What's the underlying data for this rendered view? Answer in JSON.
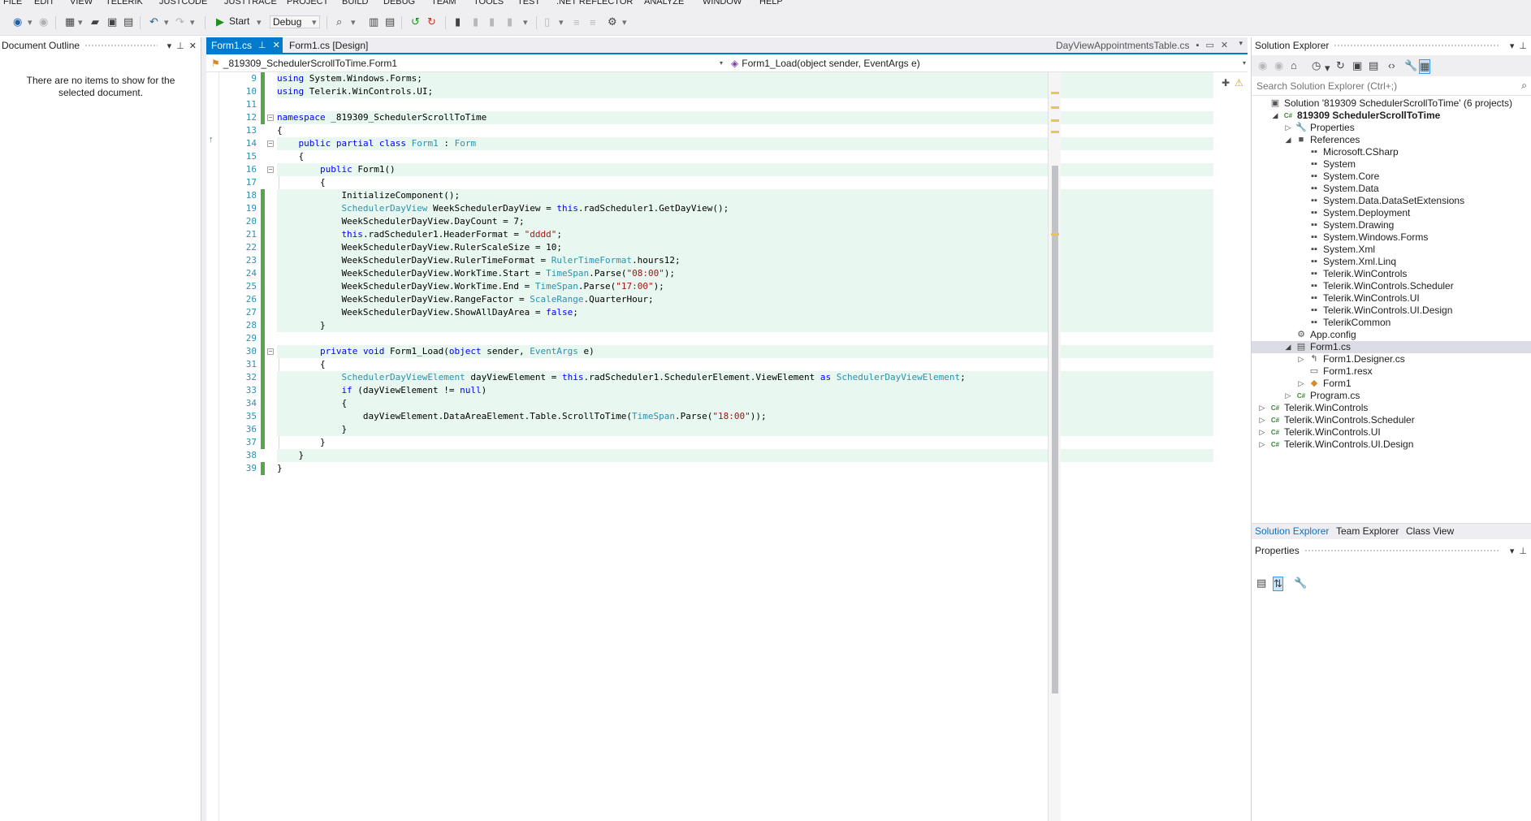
{
  "menu": [
    "FILE",
    "EDIT",
    "VIEW",
    "TELERIK",
    "JUSTCODE",
    "JUSTTRACE",
    "PROJECT",
    "BUILD",
    "DEBUG",
    "TEAM",
    "TOOLS",
    "TEST",
    ".NET REFLECTOR",
    "ANALYZE",
    "WINDOW",
    "HELP"
  ],
  "toolbar": {
    "start_label": "Start",
    "config_value": "Debug"
  },
  "document_outline": {
    "title": "Document Outline",
    "empty_message": "There are no items to show for the selected document."
  },
  "tabs": {
    "items": [
      {
        "label": "Form1.cs",
        "active": true
      },
      {
        "label": "Form1.cs [Design]",
        "active": false
      }
    ],
    "preview_tab": "DayViewAppointmentsTable.cs"
  },
  "navbar": {
    "type_combo": "_819309_SchedulerScrollToTime.Form1",
    "member_combo": "Form1_Load(object sender, EventArgs e)"
  },
  "code": [
    {
      "n": "9",
      "fold": "",
      "hl": true,
      "chg": "saved",
      "indent": 0,
      "segs": [
        [
          "k",
          "using"
        ],
        [
          "p",
          " System.Windows.Forms;"
        ]
      ]
    },
    {
      "n": "10",
      "fold": "",
      "hl": true,
      "chg": "saved",
      "indent": 0,
      "segs": [
        [
          "k",
          "using"
        ],
        [
          "p",
          " Telerik.WinControls.UI;"
        ]
      ]
    },
    {
      "n": "11",
      "fold": "",
      "hl": false,
      "chg": "saved",
      "indent": 0,
      "segs": []
    },
    {
      "n": "12",
      "fold": "−",
      "hl": true,
      "chg": "saved",
      "indent": 0,
      "segs": [
        [
          "k",
          "namespace"
        ],
        [
          "p",
          " _819309_SchedulerScrollToTime"
        ]
      ]
    },
    {
      "n": "13",
      "fold": "",
      "hl": false,
      "chg": "",
      "indent": 0,
      "segs": [
        [
          "p",
          "{"
        ]
      ]
    },
    {
      "n": "14",
      "fold": "−",
      "hl": true,
      "chg": "",
      "indent": 1,
      "segs": [
        [
          "k",
          "public"
        ],
        [
          "p",
          " "
        ],
        [
          "k",
          "partial"
        ],
        [
          "p",
          " "
        ],
        [
          "k",
          "class"
        ],
        [
          "p",
          " "
        ],
        [
          "t",
          "Form1"
        ],
        [
          "p",
          " : "
        ],
        [
          "t",
          "Form"
        ]
      ]
    },
    {
      "n": "15",
      "fold": "",
      "hl": false,
      "chg": "",
      "indent": 1,
      "segs": [
        [
          "p",
          "{"
        ]
      ]
    },
    {
      "n": "16",
      "fold": "−",
      "hl": true,
      "chg": "",
      "indent": 2,
      "segs": [
        [
          "k",
          "public"
        ],
        [
          "p",
          " Form1()"
        ]
      ]
    },
    {
      "n": "17",
      "fold": "",
      "hl": false,
      "chg": "",
      "indent": 2,
      "segs": [
        [
          "p",
          "{"
        ]
      ]
    },
    {
      "n": "18",
      "fold": "",
      "hl": true,
      "chg": "saved",
      "indent": 3,
      "segs": [
        [
          "p",
          "InitializeComponent();"
        ]
      ]
    },
    {
      "n": "19",
      "fold": "",
      "hl": true,
      "chg": "saved",
      "indent": 3,
      "segs": [
        [
          "t",
          "SchedulerDayView"
        ],
        [
          "p",
          " WeekSchedulerDayView = "
        ],
        [
          "k",
          "this"
        ],
        [
          "p",
          ".radScheduler1.GetDayView();"
        ]
      ]
    },
    {
      "n": "20",
      "fold": "",
      "hl": true,
      "chg": "saved",
      "indent": 3,
      "segs": [
        [
          "p",
          "WeekSchedulerDayView.DayCount = 7;"
        ]
      ]
    },
    {
      "n": "21",
      "fold": "",
      "hl": true,
      "chg": "saved",
      "indent": 3,
      "segs": [
        [
          "k",
          "this"
        ],
        [
          "p",
          ".radScheduler1.HeaderFormat = "
        ],
        [
          "s",
          "\"dddd\""
        ],
        [
          "p",
          ";"
        ]
      ]
    },
    {
      "n": "22",
      "fold": "",
      "hl": true,
      "chg": "saved",
      "indent": 3,
      "segs": [
        [
          "p",
          "WeekSchedulerDayView.RulerScaleSize = 10;"
        ]
      ]
    },
    {
      "n": "23",
      "fold": "",
      "hl": true,
      "chg": "saved",
      "indent": 3,
      "segs": [
        [
          "p",
          "WeekSchedulerDayView.RulerTimeFormat = "
        ],
        [
          "t",
          "RulerTimeFormat"
        ],
        [
          "p",
          ".hours12;"
        ]
      ]
    },
    {
      "n": "24",
      "fold": "",
      "hl": true,
      "chg": "saved",
      "indent": 3,
      "segs": [
        [
          "p",
          "WeekSchedulerDayView.WorkTime.Start = "
        ],
        [
          "t",
          "TimeSpan"
        ],
        [
          "p",
          ".Parse("
        ],
        [
          "s",
          "\"08:00\""
        ],
        [
          "p",
          ");"
        ]
      ]
    },
    {
      "n": "25",
      "fold": "",
      "hl": true,
      "chg": "saved",
      "indent": 3,
      "segs": [
        [
          "p",
          "WeekSchedulerDayView.WorkTime.End = "
        ],
        [
          "t",
          "TimeSpan"
        ],
        [
          "p",
          ".Parse("
        ],
        [
          "s",
          "\"17:00\""
        ],
        [
          "p",
          ");"
        ]
      ]
    },
    {
      "n": "26",
      "fold": "",
      "hl": true,
      "chg": "saved",
      "indent": 3,
      "segs": [
        [
          "p",
          "WeekSchedulerDayView.RangeFactor = "
        ],
        [
          "t",
          "ScaleRange"
        ],
        [
          "p",
          ".QuarterHour;"
        ]
      ]
    },
    {
      "n": "27",
      "fold": "",
      "hl": true,
      "chg": "saved",
      "indent": 3,
      "segs": [
        [
          "p",
          "WeekSchedulerDayView.ShowAllDayArea = "
        ],
        [
          "k",
          "false"
        ],
        [
          "p",
          ";"
        ]
      ]
    },
    {
      "n": "28",
      "fold": "",
      "hl": true,
      "chg": "saved",
      "indent": 2,
      "segs": [
        [
          "p",
          "}"
        ]
      ]
    },
    {
      "n": "29",
      "fold": "",
      "hl": false,
      "chg": "saved",
      "indent": 0,
      "segs": []
    },
    {
      "n": "30",
      "fold": "−",
      "hl": true,
      "chg": "saved",
      "indent": 2,
      "segs": [
        [
          "k",
          "private"
        ],
        [
          "p",
          " "
        ],
        [
          "k",
          "void"
        ],
        [
          "p",
          " Form1_Load("
        ],
        [
          "k",
          "object"
        ],
        [
          "p",
          " sender, "
        ],
        [
          "t",
          "EventArgs"
        ],
        [
          "p",
          " e)"
        ]
      ]
    },
    {
      "n": "31",
      "fold": "",
      "hl": false,
      "chg": "saved",
      "indent": 2,
      "segs": [
        [
          "p",
          "{"
        ]
      ]
    },
    {
      "n": "32",
      "fold": "",
      "hl": true,
      "chg": "saved",
      "indent": 3,
      "segs": [
        [
          "t",
          "SchedulerDayViewElement"
        ],
        [
          "p",
          " dayViewElement = "
        ],
        [
          "k",
          "this"
        ],
        [
          "p",
          ".radScheduler1.SchedulerElement.ViewElement "
        ],
        [
          "k",
          "as"
        ],
        [
          "p",
          " "
        ],
        [
          "t",
          "SchedulerDayViewElement"
        ],
        [
          "p",
          ";"
        ]
      ]
    },
    {
      "n": "33",
      "fold": "",
      "hl": true,
      "chg": "saved",
      "indent": 3,
      "segs": [
        [
          "k",
          "if"
        ],
        [
          "p",
          " (dayViewElement != "
        ],
        [
          "k",
          "null"
        ],
        [
          "p",
          ")"
        ]
      ]
    },
    {
      "n": "34",
      "fold": "",
      "hl": true,
      "chg": "saved",
      "indent": 3,
      "segs": [
        [
          "p",
          "{"
        ]
      ]
    },
    {
      "n": "35",
      "fold": "",
      "hl": true,
      "chg": "saved",
      "indent": 4,
      "segs": [
        [
          "p",
          "dayViewElement.DataAreaElement.Table.ScrollToTime("
        ],
        [
          "t",
          "TimeSpan"
        ],
        [
          "p",
          ".Parse("
        ],
        [
          "s",
          "\"18:00\""
        ],
        [
          "p",
          "));"
        ]
      ]
    },
    {
      "n": "36",
      "fold": "",
      "hl": true,
      "chg": "saved",
      "indent": 3,
      "segs": [
        [
          "p",
          "}"
        ]
      ]
    },
    {
      "n": "37",
      "fold": "",
      "hl": false,
      "chg": "saved",
      "indent": 2,
      "segs": [
        [
          "p",
          "}"
        ]
      ]
    },
    {
      "n": "38",
      "fold": "",
      "hl": true,
      "chg": "",
      "indent": 1,
      "segs": [
        [
          "p",
          "}"
        ]
      ]
    },
    {
      "n": "39",
      "fold": "",
      "hl": false,
      "chg": "saved",
      "indent": 0,
      "segs": [
        [
          "p",
          "}"
        ]
      ]
    }
  ],
  "solution_explorer": {
    "title": "Solution Explorer",
    "search_placeholder": "Search Solution Explorer (Ctrl+;)",
    "tree": [
      {
        "depth": 0,
        "exp": "",
        "icon": "solution-icon",
        "glyph": "▣",
        "color": "#555555",
        "label": "Solution '819309 SchedulerScrollToTime' (6 projects)",
        "bold": false,
        "sel": false
      },
      {
        "depth": 1,
        "exp": "◢",
        "icon": "csharp-project-icon",
        "glyph": "C#",
        "color": "#388a34",
        "label": "819309 SchedulerScrollToTime",
        "bold": true,
        "sel": false
      },
      {
        "depth": 2,
        "exp": "▷",
        "icon": "wrench-icon",
        "glyph": "🔧",
        "color": "#555555",
        "label": "Properties",
        "bold": false,
        "sel": false
      },
      {
        "depth": 2,
        "exp": "◢",
        "icon": "references-icon",
        "glyph": "■",
        "color": "#555555",
        "label": "References",
        "bold": false,
        "sel": false
      },
      {
        "depth": 3,
        "exp": "",
        "icon": "assembly-icon",
        "glyph": "▪▪",
        "color": "#444444",
        "label": "Microsoft.CSharp",
        "bold": false,
        "sel": false
      },
      {
        "depth": 3,
        "exp": "",
        "icon": "assembly-icon",
        "glyph": "▪▪",
        "color": "#444444",
        "label": "System",
        "bold": false,
        "sel": false
      },
      {
        "depth": 3,
        "exp": "",
        "icon": "assembly-icon",
        "glyph": "▪▪",
        "color": "#444444",
        "label": "System.Core",
        "bold": false,
        "sel": false
      },
      {
        "depth": 3,
        "exp": "",
        "icon": "assembly-icon",
        "glyph": "▪▪",
        "color": "#444444",
        "label": "System.Data",
        "bold": false,
        "sel": false
      },
      {
        "depth": 3,
        "exp": "",
        "icon": "assembly-icon",
        "glyph": "▪▪",
        "color": "#444444",
        "label": "System.Data.DataSetExtensions",
        "bold": false,
        "sel": false
      },
      {
        "depth": 3,
        "exp": "",
        "icon": "assembly-icon",
        "glyph": "▪▪",
        "color": "#444444",
        "label": "System.Deployment",
        "bold": false,
        "sel": false
      },
      {
        "depth": 3,
        "exp": "",
        "icon": "assembly-icon",
        "glyph": "▪▪",
        "color": "#444444",
        "label": "System.Drawing",
        "bold": false,
        "sel": false
      },
      {
        "depth": 3,
        "exp": "",
        "icon": "assembly-icon",
        "glyph": "▪▪",
        "color": "#444444",
        "label": "System.Windows.Forms",
        "bold": false,
        "sel": false
      },
      {
        "depth": 3,
        "exp": "",
        "icon": "assembly-icon",
        "glyph": "▪▪",
        "color": "#444444",
        "label": "System.Xml",
        "bold": false,
        "sel": false
      },
      {
        "depth": 3,
        "exp": "",
        "icon": "assembly-icon",
        "glyph": "▪▪",
        "color": "#444444",
        "label": "System.Xml.Linq",
        "bold": false,
        "sel": false
      },
      {
        "depth": 3,
        "exp": "",
        "icon": "assembly-icon",
        "glyph": "▪▪",
        "color": "#444444",
        "label": "Telerik.WinControls",
        "bold": false,
        "sel": false
      },
      {
        "depth": 3,
        "exp": "",
        "icon": "assembly-icon",
        "glyph": "▪▪",
        "color": "#444444",
        "label": "Telerik.WinControls.Scheduler",
        "bold": false,
        "sel": false
      },
      {
        "depth": 3,
        "exp": "",
        "icon": "assembly-icon",
        "glyph": "▪▪",
        "color": "#444444",
        "label": "Telerik.WinControls.UI",
        "bold": false,
        "sel": false
      },
      {
        "depth": 3,
        "exp": "",
        "icon": "assembly-icon",
        "glyph": "▪▪",
        "color": "#444444",
        "label": "Telerik.WinControls.UI.Design",
        "bold": false,
        "sel": false
      },
      {
        "depth": 3,
        "exp": "",
        "icon": "assembly-icon",
        "glyph": "▪▪",
        "color": "#444444",
        "label": "TelerikCommon",
        "bold": false,
        "sel": false
      },
      {
        "depth": 2,
        "exp": "",
        "icon": "config-file-icon",
        "glyph": "⚙",
        "color": "#555555",
        "label": "App.config",
        "bold": false,
        "sel": false
      },
      {
        "depth": 2,
        "exp": "◢",
        "icon": "form-file-icon",
        "glyph": "▤",
        "color": "#555555",
        "label": "Form1.cs",
        "bold": false,
        "sel": true
      },
      {
        "depth": 3,
        "exp": "▷",
        "icon": "csharp-file-icon",
        "glyph": "↰",
        "color": "#555555",
        "label": "Form1.Designer.cs",
        "bold": false,
        "sel": false
      },
      {
        "depth": 3,
        "exp": "",
        "icon": "resx-file-icon",
        "glyph": "▭",
        "color": "#555555",
        "label": "Form1.resx",
        "bold": false,
        "sel": false
      },
      {
        "depth": 3,
        "exp": "▷",
        "icon": "class-icon",
        "glyph": "◆",
        "color": "#d68b2b",
        "label": "Form1",
        "bold": false,
        "sel": false
      },
      {
        "depth": 2,
        "exp": "▷",
        "icon": "csharp-file-icon",
        "glyph": "C#",
        "color": "#388a34",
        "label": "Program.cs",
        "bold": false,
        "sel": false
      },
      {
        "depth": 0,
        "exp": "▷",
        "icon": "csharp-project-icon",
        "glyph": "C#",
        "color": "#388a34",
        "label": "Telerik.WinControls",
        "bold": false,
        "sel": false
      },
      {
        "depth": 0,
        "exp": "▷",
        "icon": "csharp-project-icon",
        "glyph": "C#",
        "color": "#388a34",
        "label": "Telerik.WinControls.Scheduler",
        "bold": false,
        "sel": false
      },
      {
        "depth": 0,
        "exp": "▷",
        "icon": "csharp-project-icon",
        "glyph": "C#",
        "color": "#388a34",
        "label": "Telerik.WinControls.UI",
        "bold": false,
        "sel": false
      },
      {
        "depth": 0,
        "exp": "▷",
        "icon": "csharp-project-icon",
        "glyph": "C#",
        "color": "#388a34",
        "label": "Telerik.WinControls.UI.Design",
        "bold": false,
        "sel": false
      }
    ],
    "bottom_tabs": [
      "Solution Explorer",
      "Team Explorer",
      "Class View"
    ]
  },
  "properties": {
    "title": "Properties"
  }
}
